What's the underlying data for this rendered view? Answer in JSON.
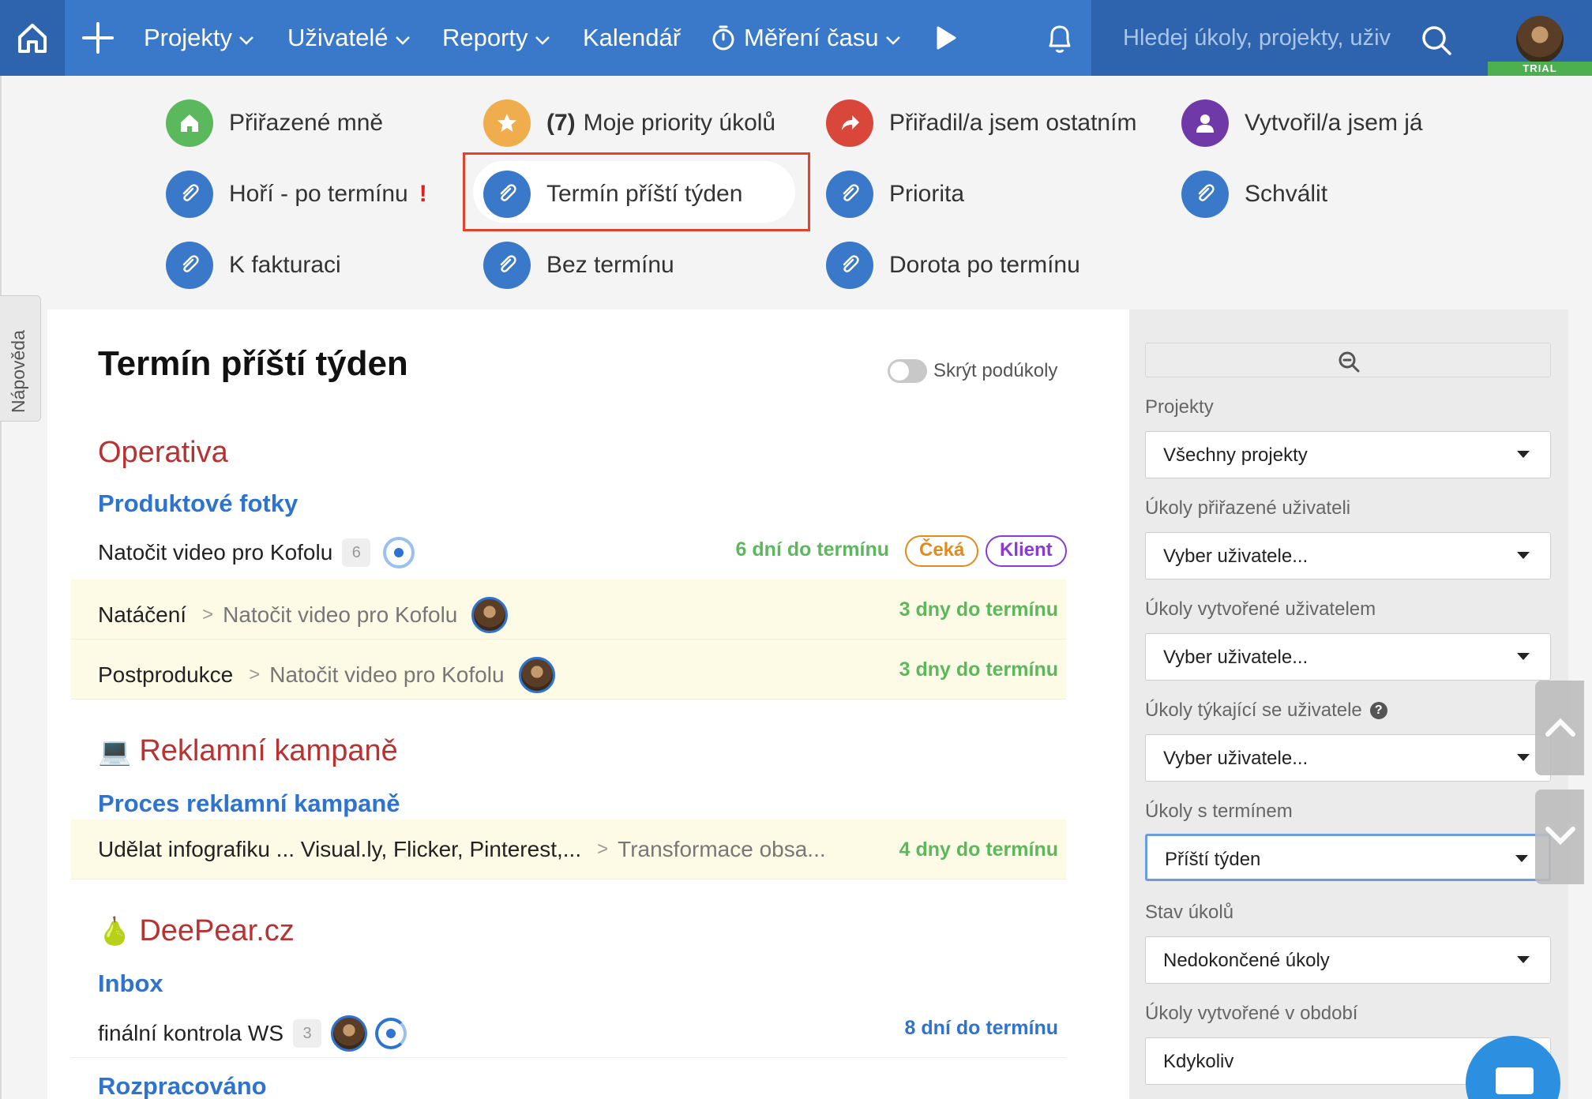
{
  "topbar": {
    "nav": [
      {
        "label": "Projekty",
        "chevron": true
      },
      {
        "label": "Uživatelé",
        "chevron": true
      },
      {
        "label": "Reporty",
        "chevron": true
      },
      {
        "label": "Kalendář",
        "chevron": false
      },
      {
        "label": "Měření času",
        "chevron": true
      }
    ],
    "search_placeholder": "Hledej úkoly, projekty, uživ",
    "trial_label": "TRIAL"
  },
  "shortcuts": [
    {
      "label": "Přiřazené mně",
      "icon": "home-icon",
      "color": "#5cb85c"
    },
    {
      "count": "(7)",
      "label": "Moje priority úkolů",
      "icon": "star-icon",
      "color": "#f0ad4e"
    },
    {
      "label": "Přiřadil/a jsem ostatním",
      "icon": "forward-arrow-icon",
      "color": "#d9473b"
    },
    {
      "label": "Vytvořil/a jsem já",
      "icon": "user-icon",
      "color": "#6f3aa8"
    },
    {
      "label": "Hoří - po termínu",
      "icon": "paperclip-icon",
      "color": "#3a78c9",
      "alert": "!"
    },
    {
      "label": "Termín příští týden",
      "icon": "paperclip-icon",
      "color": "#3a78c9",
      "selected": true
    },
    {
      "label": "Priorita",
      "icon": "paperclip-icon",
      "color": "#3a78c9"
    },
    {
      "label": "Schválit",
      "icon": "paperclip-icon",
      "color": "#3a78c9"
    },
    {
      "label": "K fakturaci",
      "icon": "paperclip-icon",
      "color": "#3a78c9"
    },
    {
      "label": "Bez termínu",
      "icon": "paperclip-icon",
      "color": "#3a78c9"
    },
    {
      "label": "Dorota po termínu",
      "icon": "paperclip-icon",
      "color": "#3a78c9"
    }
  ],
  "help_tab": "Nápověda",
  "main": {
    "title": "Termín příští týden",
    "toggle_label": "Skrýt podúkoly",
    "projects": [
      {
        "name": "Operativa",
        "emoji": "",
        "groups": [
          {
            "name": "Produktové fotky",
            "tasks": [
              {
                "title": "Natočit video pro Kofolu",
                "count": "6",
                "due": "6 dní do termínu",
                "badges": [
                  "Čeká",
                  "Klient"
                ]
              },
              {
                "title": "Natáčení",
                "parent": "Natočit video pro Kofolu",
                "due": "3 dny do termínu"
              },
              {
                "title": "Postprodukce",
                "parent": "Natočit video pro Kofolu",
                "due": "3 dny do termínu"
              }
            ]
          }
        ]
      },
      {
        "name": "Reklamní kampaně",
        "emoji": "💻",
        "groups": [
          {
            "name": "Proces reklamní kampaně",
            "tasks": [
              {
                "title": "Udělat infografiku ... Visual.ly, Flicker, Pinterest,...",
                "parent": "Transformace obsa...",
                "due": "4 dny do termínu"
              }
            ]
          }
        ]
      },
      {
        "name": "DeePear.cz",
        "emoji": "🍐",
        "groups": [
          {
            "name": "Inbox",
            "tasks": [
              {
                "title": "finální kontrola WS",
                "count": "3",
                "due": "8 dní do termínu"
              }
            ]
          },
          {
            "name": "Rozpracováno",
            "tasks": []
          }
        ]
      }
    ]
  },
  "filters": [
    {
      "label": "Projekty",
      "value": "Všechny projekty"
    },
    {
      "label": "Úkoly přiřazené uživateli",
      "value": "Vyber uživatele..."
    },
    {
      "label": "Úkoly vytvořené uživatelem",
      "value": "Vyber uživatele..."
    },
    {
      "label": "Úkoly týkající se uživatele",
      "value": "Vyber uživatele...",
      "help": "?"
    },
    {
      "label": "Úkoly s termínem",
      "value": "Příští týden",
      "focused": true
    },
    {
      "label": "Stav úkolů",
      "value": "Nedokončené úkoly"
    },
    {
      "label": "Úkoly vytvořené v období",
      "value": "Kdykoliv"
    }
  ],
  "colors": {
    "accent": "#3a78c9",
    "project": "#b83232",
    "group": "#2d73cf",
    "due_green": "#5cb85c"
  }
}
